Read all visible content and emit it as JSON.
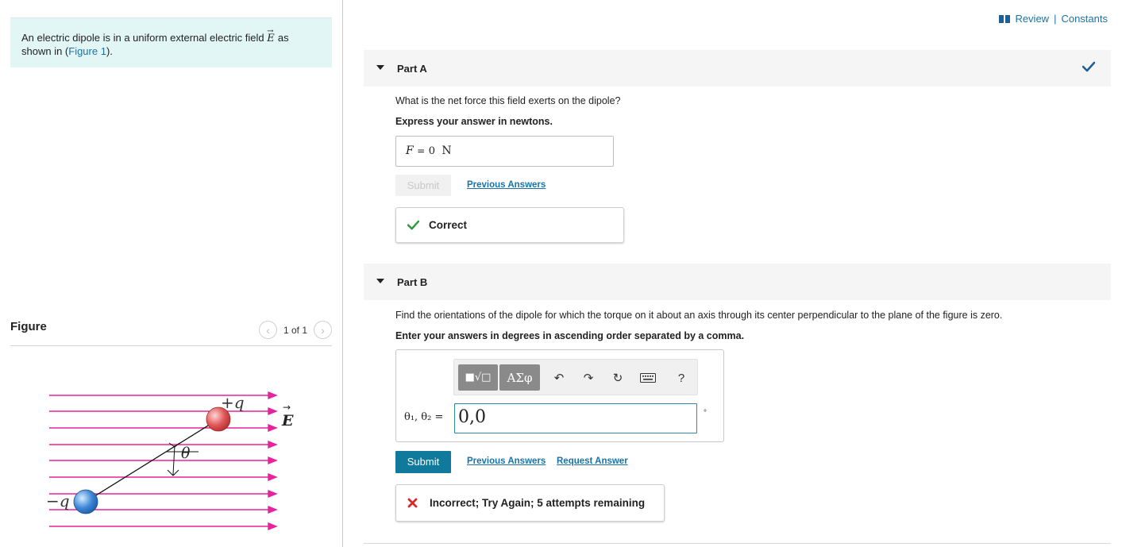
{
  "header": {
    "review_label": "Review",
    "separator": "|",
    "constants_label": "Constants",
    "colors": {
      "link": "#1a73a8",
      "check": "#1f5f95"
    }
  },
  "intro": {
    "text_before": "An electric dipole is in a uniform external electric field ",
    "vector": "E",
    "text_middle": " as shown in (",
    "figure_link": "Figure 1",
    "text_after": ")."
  },
  "figure": {
    "title": "Figure",
    "pager": "1 of 1",
    "labels": {
      "plus_q": "+q",
      "minus_q": "−q",
      "field": "E",
      "angle": "θ"
    },
    "colors": {
      "field_lines": "#e8229a",
      "positive_charge": "#e05555",
      "negative_charge": "#3d86d8"
    }
  },
  "partA": {
    "title": "Part A",
    "question": "What is the net force this field exerts on the dipole?",
    "instruction": "Express your answer in newtons.",
    "variable": "F",
    "equals": "=",
    "value": "0",
    "unit": "N",
    "submit_label": "Submit",
    "previous_answers_label": "Previous Answers",
    "feedback": "Correct",
    "status": "correct"
  },
  "partB": {
    "title": "Part B",
    "question": "Find the orientations of the dipole for which the torque on it about an axis through its center perpendicular to the plane of the figure is zero.",
    "instruction": "Enter your answers in degrees in ascending order separated by a comma.",
    "toolbar": {
      "template_btn": "■√□",
      "symbols_btn": "ΑΣφ",
      "help": "?"
    },
    "variable_label": "θ₁, θ₂ =",
    "value": "0,0",
    "unit": "°",
    "submit_label": "Submit",
    "previous_answers_label": "Previous Answers",
    "request_answer_label": "Request Answer",
    "feedback": "Incorrect; Try Again; 5 attempts remaining",
    "colors": {
      "submit": "#0f7a9c",
      "error": "#d62b2b",
      "correct": "#2e9a3a"
    }
  }
}
